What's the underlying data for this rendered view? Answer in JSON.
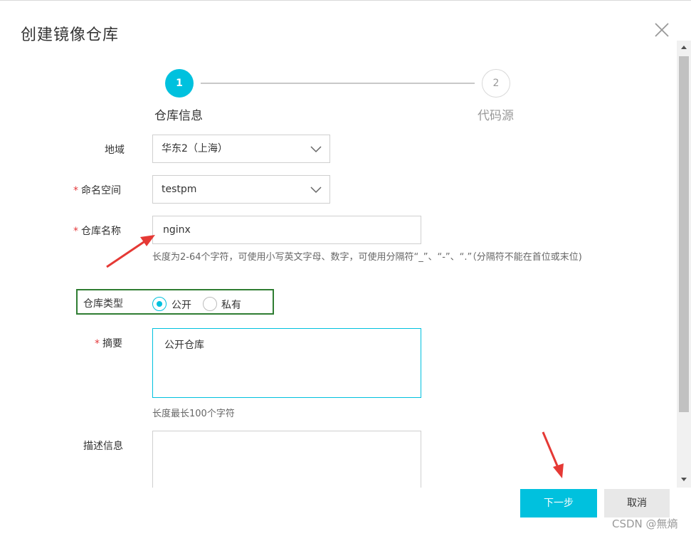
{
  "dialog": {
    "title": "创建镜像仓库",
    "close_icon": "close-icon"
  },
  "stepper": {
    "steps": [
      {
        "number": "1",
        "label": "仓库信息",
        "active": true
      },
      {
        "number": "2",
        "label": "代码源",
        "active": false
      }
    ]
  },
  "form": {
    "region": {
      "label": "地域",
      "value": "华东2（上海）"
    },
    "namespace": {
      "required_mark": "*",
      "label": "命名空间",
      "value": "testpm"
    },
    "repo_name": {
      "required_mark": "*",
      "label": "仓库名称",
      "value": "nginx",
      "hint": "长度为2-64个字符，可使用小写英文字母、数字，可使用分隔符“_”、“-”、“.”（分隔符不能在首位或末位)"
    },
    "repo_type": {
      "label": "仓库类型",
      "options": [
        {
          "label": "公开",
          "checked": true
        },
        {
          "label": "私有",
          "checked": false
        }
      ]
    },
    "summary": {
      "required_mark": "*",
      "label": "摘要",
      "value": "公开仓库",
      "hint": "长度最长100个字符"
    },
    "description": {
      "label": "描述信息",
      "value": ""
    }
  },
  "footer": {
    "next_label": "下一步",
    "cancel_label": "取消"
  },
  "watermark": "CSDN @無熵",
  "colors": {
    "accent": "#00c1de",
    "required": "#e4393c",
    "highlight_box": "#2f7d32",
    "annotation_arrow": "#e53935"
  }
}
